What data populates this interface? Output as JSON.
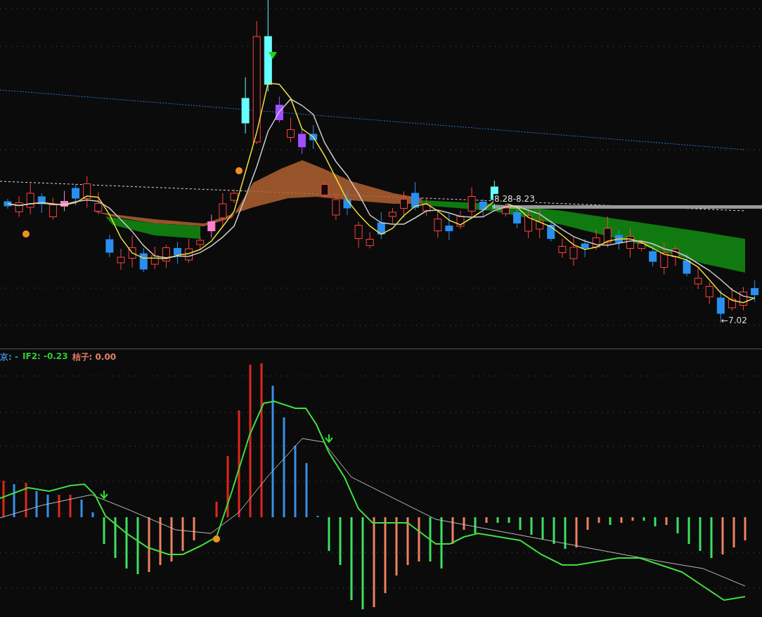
{
  "price_panel": {
    "range_label": "8.28-8.23",
    "low_label": "←7.02"
  },
  "indicator_panel": {
    "legend": [
      {
        "text": "京: -",
        "color": "#3a8fd8"
      },
      {
        "text": "IF2: -0.23",
        "color": "#33cc33"
      },
      {
        "text": "桔子: 0.00",
        "color": "#e8806a"
      }
    ]
  }
}
